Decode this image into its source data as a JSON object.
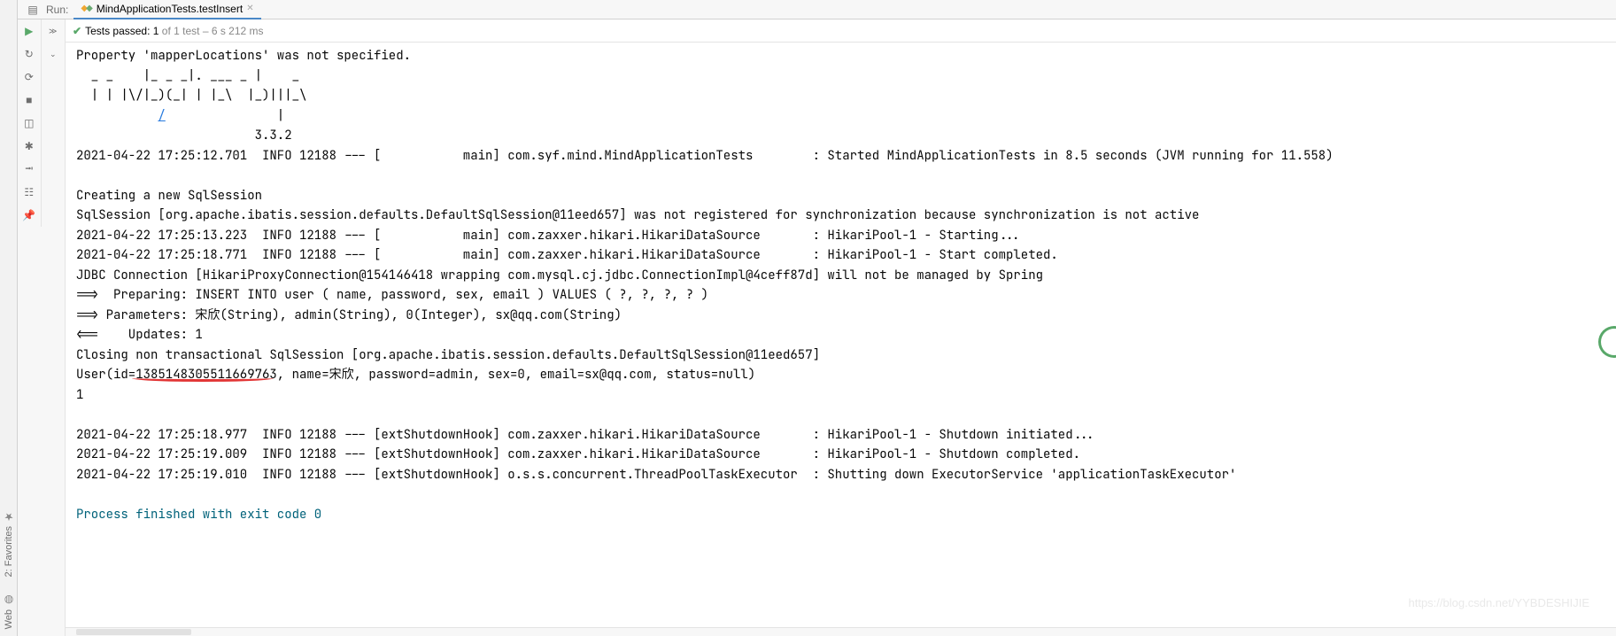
{
  "top": {
    "run_label": "Run:",
    "tab_name": "MindApplicationTests.testInsert"
  },
  "status": {
    "passed_prefix": "Tests passed: ",
    "passed_count": "1",
    "of_text": " of 1 test",
    "time_text": " – 6 s 212 ms"
  },
  "leftrail": {
    "favorites": "2: Favorites",
    "web": "Web"
  },
  "console": {
    "l1": "Property 'mapperLocations' was not specified.",
    "l2": "  _ _    |_ _ _|. ___ _ |    _",
    "l3": "  | | |\\/|_)(_| | |_\\  |_)|||_\\",
    "l4a": "           ",
    "l4_link": "/",
    "l4b": "               |",
    "l5": "                        3.3.2 ",
    "l6": "2021-04-22 17:25:12.701  INFO 12188 --- [           main] com.syf.mind.MindApplicationTests        : Started MindApplicationTests in 8.5 seconds (JVM running for 11.558)",
    "l7": "",
    "l8": "Creating a new SqlSession",
    "l9": "SqlSession [org.apache.ibatis.session.defaults.DefaultSqlSession@11eed657] was not registered for synchronization because synchronization is not active",
    "l10": "2021-04-22 17:25:13.223  INFO 12188 --- [           main] com.zaxxer.hikari.HikariDataSource       : HikariPool-1 - Starting...",
    "l11": "2021-04-22 17:25:18.771  INFO 12188 --- [           main] com.zaxxer.hikari.HikariDataSource       : HikariPool-1 - Start completed.",
    "l12": "JDBC Connection [HikariProxyConnection@154146418 wrapping com.mysql.cj.jdbc.ConnectionImpl@4ceff87d] will not be managed by Spring",
    "l13": "==>  Preparing: INSERT INTO user ( name, password, sex, email ) VALUES ( ?, ?, ?, ? )",
    "l14": "==> Parameters: 宋欣(String), admin(String), 0(Integer), sx@qq.com(String)",
    "l15": "<==    Updates: 1",
    "l16": "Closing non transactional SqlSession [org.apache.ibatis.session.defaults.DefaultSqlSession@11eed657]",
    "l17": "User(id=1385148305511669763, name=宋欣, password=admin, sex=0, email=sx@qq.com, status=null)",
    "l18": "1",
    "l19": "",
    "l20": "2021-04-22 17:25:18.977  INFO 12188 --- [extShutdownHook] com.zaxxer.hikari.HikariDataSource       : HikariPool-1 - Shutdown initiated...",
    "l21": "2021-04-22 17:25:19.009  INFO 12188 --- [extShutdownHook] com.zaxxer.hikari.HikariDataSource       : HikariPool-1 - Shutdown completed.",
    "l22": "2021-04-22 17:25:19.010  INFO 12188 --- [extShutdownHook] o.s.s.concurrent.ThreadPoolTaskExecutor  : Shutting down ExecutorService 'applicationTaskExecutor'",
    "l23": "",
    "l24": "Process finished with exit code 0"
  },
  "watermark": "https://blog.csdn.net/YYBDESHIJIE"
}
